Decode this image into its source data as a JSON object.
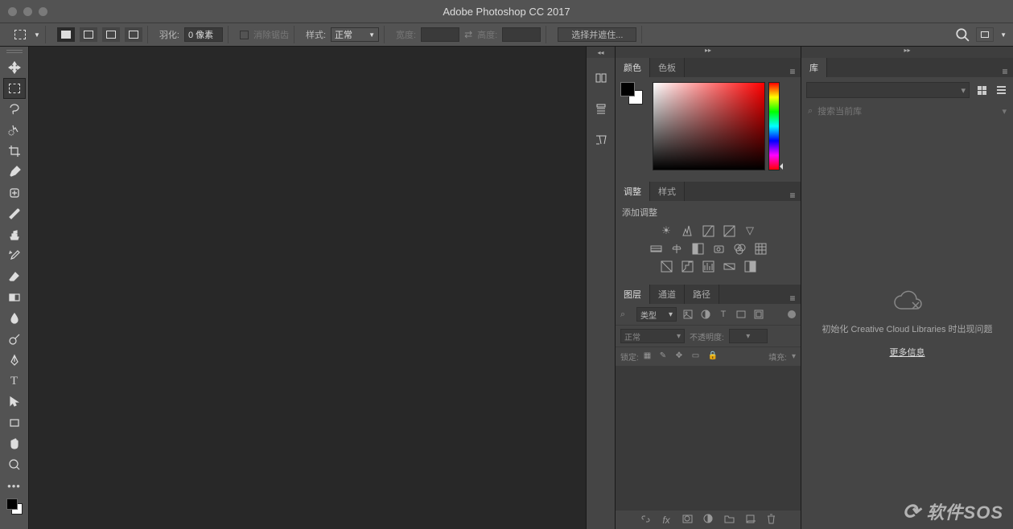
{
  "title": "Adobe Photoshop CC 2017",
  "optionsbar": {
    "feather_label": "羽化:",
    "feather_value": "0 像素",
    "antialias_label": "消除锯齿",
    "style_label": "样式:",
    "style_value": "正常",
    "width_label": "宽度:",
    "height_label": "高度:",
    "select_mask_btn": "选择并遮住..."
  },
  "tools": {
    "move": "move-tool",
    "marquee": "marquee-tool",
    "lasso": "lasso-tool",
    "quickselect": "quick-select-tool",
    "crop": "crop-tool",
    "eyedropper": "eyedropper-tool",
    "healing": "healing-brush-tool",
    "brush": "brush-tool",
    "stamp": "clone-stamp-tool",
    "history": "history-brush-tool",
    "eraser": "eraser-tool",
    "gradient": "gradient-tool",
    "blur": "blur-tool",
    "dodge": "dodge-tool",
    "pen": "pen-tool",
    "type": "type-tool",
    "path": "path-select-tool",
    "shape": "shape-tool",
    "hand": "hand-tool",
    "zoom": "zoom-tool"
  },
  "panels": {
    "color_tab": "颜色",
    "swatches_tab": "色板",
    "adjust_tab": "调整",
    "styles_tab": "样式",
    "adjust_header": "添加调整",
    "layers_tab": "图层",
    "channels_tab": "通道",
    "paths_tab": "路径",
    "kind_label": "类型",
    "blend_label": "正常",
    "opacity_label": "不透明度:",
    "lock_label": "锁定:",
    "fill_label": "填充:"
  },
  "library": {
    "tab": "库",
    "search_placeholder": "搜索当前库",
    "error_text": "初始化 Creative Cloud Libraries 时出现问题",
    "more_link": "更多信息"
  },
  "watermark": "软件SOS"
}
